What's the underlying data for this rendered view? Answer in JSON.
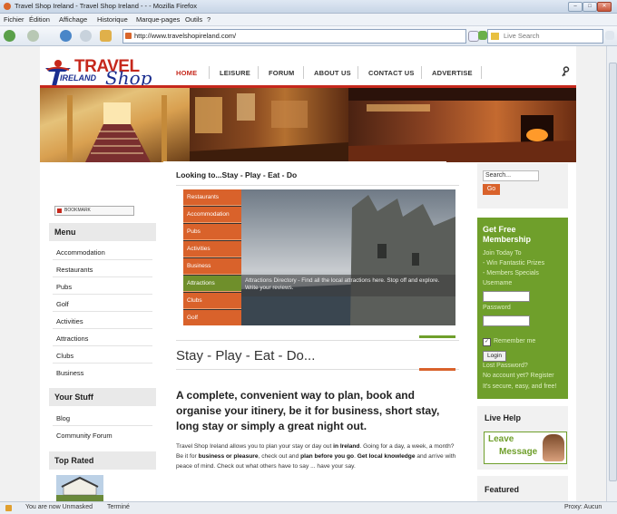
{
  "window": {
    "title": "Travel Shop Ireland - Travel Shop Ireland - - - Mozilla Firefox"
  },
  "menubar": [
    "Fichier",
    "Édition",
    "Affichage",
    "Historique",
    "Marque-pages",
    "Outils",
    "?"
  ],
  "navbar": {
    "url": "http://www.travelshopireland.com/",
    "search_placeholder": "Live Search"
  },
  "site": {
    "logo": {
      "line1": "TRAVEL",
      "line2": "IRELAND",
      "line3": "Shop"
    },
    "topnav": [
      "HOME",
      "LEISURE",
      "FORUM",
      "ABOUT US",
      "CONTACT US",
      "ADVERTISE"
    ],
    "bookmark_label": "BOOKMARK",
    "menu": {
      "title": "Menu",
      "items": [
        "Accommodation",
        "Restaurants",
        "Pubs",
        "Golf",
        "Activities",
        "Attractions",
        "Clubs",
        "Business"
      ]
    },
    "your_stuff": {
      "title": "Your Stuff",
      "items": [
        "Blog",
        "Community Forum"
      ]
    },
    "top_rated": {
      "title": "Top Rated"
    },
    "center": {
      "looking": "Looking to...Stay - Play - Eat - Do",
      "tabs": [
        "Restaurants",
        "Accommodation",
        "Pubs",
        "Activities",
        "Business",
        "Attractions",
        "Clubs",
        "Golf"
      ],
      "active_tab": "Attractions",
      "caption": "Attractions Directory - Find all the local attractions here. Stop off and explore. Write your reviews.",
      "heading": "Stay - Play - Eat - Do...",
      "tagline": "A complete, convenient way to plan, book and organise your itinery, be it for business, short stay, long stay or simply a great night out.",
      "body": {
        "p1": "Travel Shop Ireland allows you to plan your stay or day out ",
        "b1": "in Ireland",
        "p2": ". Going for a day, a week, a month? Be it for ",
        "b2": "business or pleasure",
        "p3": ", check out and ",
        "b3": "plan before you go",
        "p4": ". ",
        "b4": "Get local knowledge",
        "p5": " and arrive with peace of mind. Check out what others have to say ... have your say."
      }
    },
    "right": {
      "search_value": "Search...",
      "go_label": "Go",
      "membership": {
        "title": "Get Free Membership",
        "lines": [
          "Join Today To",
          "- Win Fantastic Prizes",
          "- Members Specials"
        ],
        "username_label": "Username",
        "password_label": "Password",
        "remember_label": "Remember me",
        "login_label": "Login",
        "lost_password": "Lost Password?",
        "no_account": "No account yet? Register",
        "secure": "It's secure, easy, and free!"
      },
      "live_help": {
        "title": "Live Help",
        "line1": "Leave",
        "line2": "Message"
      },
      "featured": {
        "title": "Featured"
      }
    }
  },
  "status": {
    "left1": "You are now Unmasked",
    "left2": "Terminé",
    "right": "Proxy: Aucun"
  }
}
